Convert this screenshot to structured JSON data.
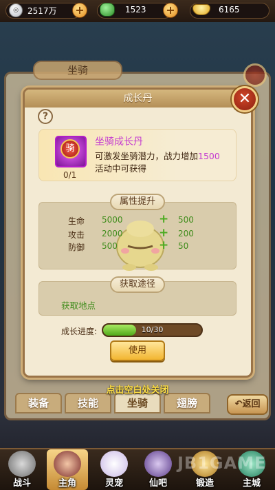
{
  "currency": {
    "silver": "2517万",
    "jade": "1523",
    "gold": "6165"
  },
  "icons": [
    "silver-coin-icon",
    "jade-icon",
    "gold-ingot-icon",
    "plus-icon",
    "help-icon",
    "close-icon",
    "mount-item-icon",
    "mascot-icon"
  ],
  "background_panel": {
    "title": "坐骑",
    "tabs": [
      "装备",
      "技能",
      "坐骑",
      "翅膀"
    ],
    "active_tab": "坐骑",
    "return_label": "返回"
  },
  "dialog": {
    "title": "成长丹",
    "help": "?",
    "close": "✕",
    "item": {
      "badge": "骑",
      "count": "0/1",
      "name": "坐骑成长丹",
      "desc_prefix": "可激发坐骑潜力，战力增加",
      "desc_value": "1500",
      "source": "活动中可获得"
    },
    "attr_section": {
      "title": "属性提升",
      "stats": [
        {
          "label": "生命",
          "value": "5000",
          "inc": "500"
        },
        {
          "label": "攻击",
          "value": "2000",
          "inc": "200"
        },
        {
          "label": "防御",
          "value": "500",
          "inc": "50"
        }
      ]
    },
    "acquire_section": {
      "title": "获取途径",
      "location": "获取地点"
    },
    "progress": {
      "label": "成长进度:",
      "text": "10/30",
      "current": 10,
      "max": 30
    },
    "use_label": "使用"
  },
  "hint": "点击空白处关闭",
  "nav": [
    {
      "label": "战斗"
    },
    {
      "label": "主角"
    },
    {
      "label": "灵宠"
    },
    {
      "label": "仙吧"
    },
    {
      "label": "锻造"
    },
    {
      "label": "主城"
    }
  ],
  "watermark": "JB1GAME",
  "colors": {
    "accent_purple": "#c43ad0",
    "stat_green": "#3f8c1b",
    "hint_yellow": "#ffdf45"
  }
}
